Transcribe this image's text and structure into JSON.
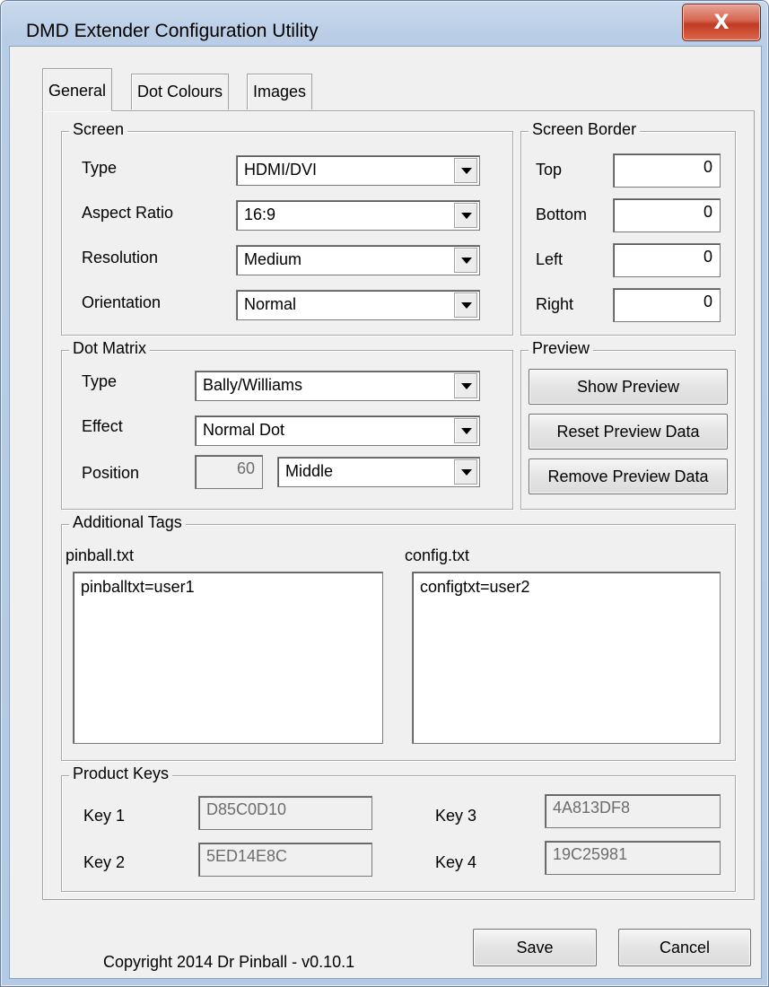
{
  "window": {
    "title": "DMD Extender Configuration Utility",
    "close_label": "X"
  },
  "tabs": [
    {
      "label": "General"
    },
    {
      "label": "Dot Colours"
    },
    {
      "label": "Images"
    }
  ],
  "screen": {
    "legend": "Screen",
    "type_label": "Type",
    "type_value": "HDMI/DVI",
    "aspect_label": "Aspect Ratio",
    "aspect_value": "16:9",
    "resolution_label": "Resolution",
    "resolution_value": "Medium",
    "orientation_label": "Orientation",
    "orientation_value": "Normal"
  },
  "border": {
    "legend": "Screen Border",
    "top_label": "Top",
    "top_value": "0",
    "bottom_label": "Bottom",
    "bottom_value": "0",
    "left_label": "Left",
    "left_value": "0",
    "right_label": "Right",
    "right_value": "0"
  },
  "dot_matrix": {
    "legend": "Dot Matrix",
    "type_label": "Type",
    "type_value": "Bally/Williams",
    "effect_label": "Effect",
    "effect_value": "Normal Dot",
    "position_label": "Position",
    "position_number": "60",
    "position_value": "Middle"
  },
  "preview": {
    "legend": "Preview",
    "show_label": "Show Preview",
    "reset_label": "Reset Preview Data",
    "remove_label": "Remove Preview Data"
  },
  "tags": {
    "legend": "Additional Tags",
    "pinball_label": "pinball.txt",
    "pinball_value": "pinballtxt=user1",
    "config_label": "config.txt",
    "config_value": "configtxt=user2"
  },
  "keys": {
    "legend": "Product Keys",
    "key1_label": "Key 1",
    "key1_value": "D85C0D10",
    "key2_label": "Key 2",
    "key2_value": "5ED14E8C",
    "key3_label": "Key 3",
    "key3_value": "4A813DF8",
    "key4_label": "Key 4",
    "key4_value": "19C25981"
  },
  "footer": {
    "copyright": "Copyright 2014 Dr Pinball - v0.10.1",
    "save_label": "Save",
    "cancel_label": "Cancel"
  }
}
